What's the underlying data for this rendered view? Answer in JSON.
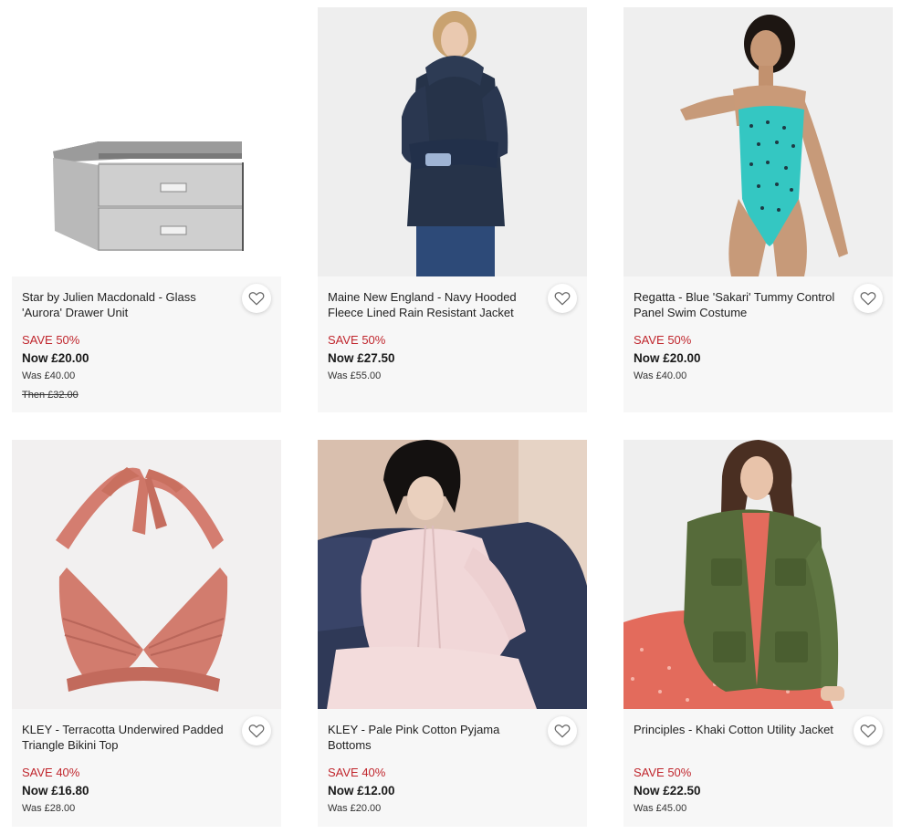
{
  "products": [
    {
      "title": "Star by Julien Macdonald - Glass 'Aurora' Drawer Unit",
      "save": "SAVE 50%",
      "now": "Now £20.00",
      "was": "Was £40.00",
      "then": "Then £32.00",
      "image": "silver-drawer-unit-image"
    },
    {
      "title": "Maine New England - Navy Hooded Fleece Lined Rain Resistant Jacket",
      "save": "SAVE 50%",
      "now": "Now £27.50",
      "was": "Was £55.00",
      "image": "navy-jacket-model-image"
    },
    {
      "title": "Regatta - Blue 'Sakari' Tummy Control Panel Swim Costume",
      "save": "SAVE 50%",
      "now": "Now £20.00",
      "was": "Was £40.00",
      "image": "turquoise-swimsuit-model-image"
    },
    {
      "title": "KLEY - Terracotta Underwired Padded Triangle Bikini Top",
      "save": "SAVE 40%",
      "now": "Now £16.80",
      "was": "Was £28.00",
      "image": "terracotta-bikini-top-image"
    },
    {
      "title": "KLEY - Pale Pink Cotton Pyjama Bottoms",
      "save": "SAVE 40%",
      "now": "Now £12.00",
      "was": "Was £20.00",
      "image": "pink-pyjamas-model-image"
    },
    {
      "title": "Principles - Khaki Cotton Utility Jacket",
      "save": "SAVE 50%",
      "now": "Now £22.50",
      "was": "Was £45.00",
      "image": "khaki-jacket-model-image"
    }
  ],
  "colors": {
    "card_bg": "#f7f7f7",
    "save_red": "#c0262d",
    "text": "#1a1a1a"
  },
  "icons": {
    "favourite": "heart-icon"
  }
}
